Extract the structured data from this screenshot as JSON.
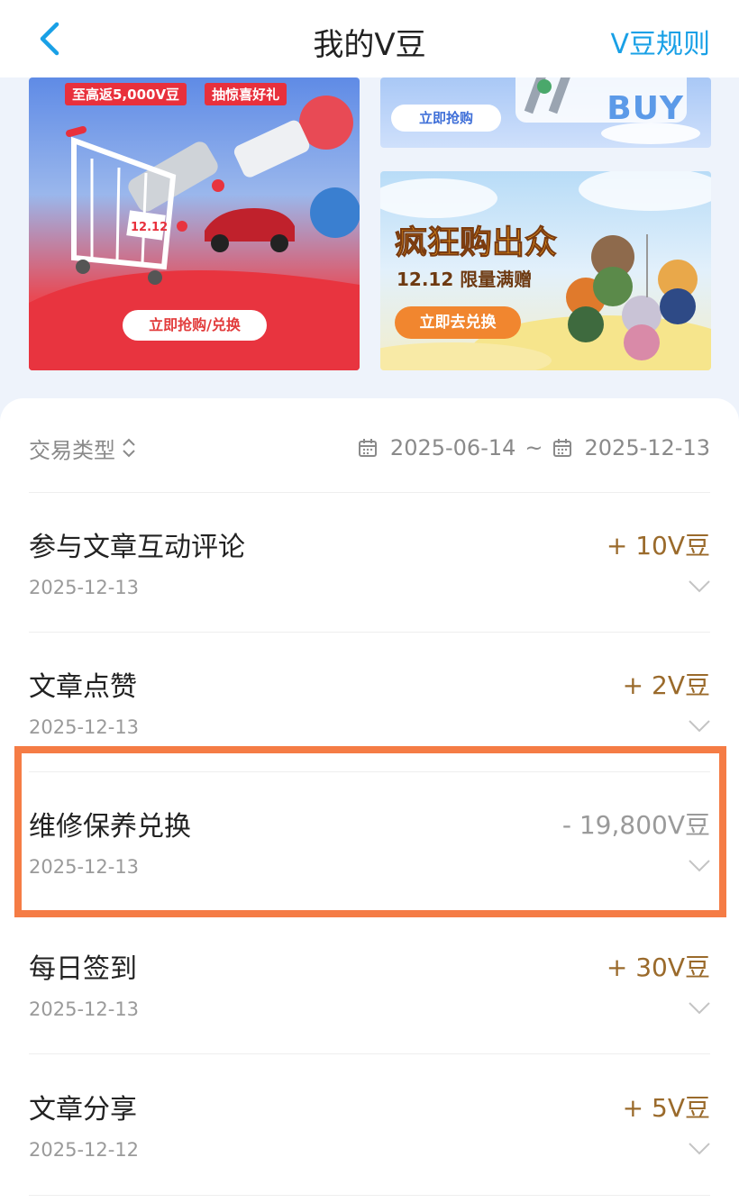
{
  "header": {
    "title": "我的V豆",
    "rules_label": "V豆规则"
  },
  "banners": {
    "left": {
      "tag_1": "至高返5,000V豆",
      "tag_2": "抽惊喜好礼",
      "badge": "12.12",
      "button": "立即抢购/兑换"
    },
    "top_right": {
      "button": "立即抢购",
      "text": "BUY"
    },
    "bottom_right": {
      "title": "疯狂购出众",
      "subtitle": "12.12 限量满赠",
      "button": "立即去兑换"
    }
  },
  "filters": {
    "type_label": "交易类型",
    "date_start": "2025-06-14",
    "date_separator": "~",
    "date_end": "2025-12-13"
  },
  "transactions": [
    {
      "name": "参与文章互动评论",
      "date": "2025-12-13",
      "amount": "+ 10V豆"
    },
    {
      "name": "文章点赞",
      "date": "2025-12-13",
      "amount": "+ 2V豆"
    },
    {
      "name": "维修保养兑换",
      "date": "2025-12-13",
      "amount": "- 19,800V豆"
    },
    {
      "name": "每日签到",
      "date": "2025-12-13",
      "amount": "+ 30V豆"
    },
    {
      "name": "文章分享",
      "date": "2025-12-12",
      "amount": "+ 5V豆"
    }
  ],
  "colors": {
    "accent": "#19a0e6",
    "earn": "#9a6a2b",
    "spend": "#9a9a9a",
    "highlight": "#f57c45"
  }
}
